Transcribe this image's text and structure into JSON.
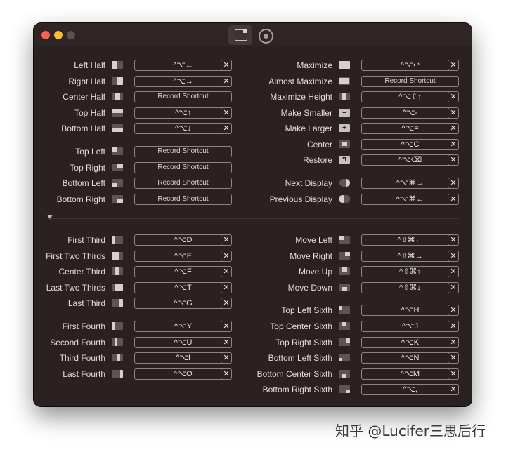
{
  "window": {
    "tabs": [
      {
        "name": "Keyboard Shortcuts",
        "icon": "keyboard-shortcuts-icon",
        "active": true
      },
      {
        "name": "Settings",
        "icon": "gear-icon",
        "active": false
      }
    ]
  },
  "shortcuts": {
    "left": [
      {
        "id": "left-half",
        "label": "Left Half",
        "shortcut": "^⌥←",
        "recorded": true,
        "icon": "left-half-icon"
      },
      {
        "id": "right-half",
        "label": "Right Half",
        "shortcut": "^⌥→",
        "recorded": true,
        "icon": "right-half-icon"
      },
      {
        "id": "center-half",
        "label": "Center Half",
        "shortcut": "Record Shortcut",
        "recorded": false,
        "icon": "center-half-icon"
      },
      {
        "id": "top-half",
        "label": "Top Half",
        "shortcut": "^⌥↑",
        "recorded": true,
        "icon": "top-half-icon"
      },
      {
        "id": "bottom-half",
        "label": "Bottom Half",
        "shortcut": "^⌥↓",
        "recorded": true,
        "icon": "bottom-half-icon"
      },
      {
        "id": "top-left",
        "label": "Top Left",
        "shortcut": "Record Shortcut",
        "recorded": false,
        "icon": "top-left-icon"
      },
      {
        "id": "top-right",
        "label": "Top Right",
        "shortcut": "Record Shortcut",
        "recorded": false,
        "icon": "top-right-icon"
      },
      {
        "id": "bottom-left",
        "label": "Bottom Left",
        "shortcut": "Record Shortcut",
        "recorded": false,
        "icon": "bottom-left-icon"
      },
      {
        "id": "bottom-right",
        "label": "Bottom Right",
        "shortcut": "Record Shortcut",
        "recorded": false,
        "icon": "bottom-right-icon"
      },
      {
        "id": "first-third",
        "label": "First Third",
        "shortcut": "^⌥D",
        "recorded": true,
        "icon": "first-third-icon"
      },
      {
        "id": "first-two-thirds",
        "label": "First Two Thirds",
        "shortcut": "^⌥E",
        "recorded": true,
        "icon": "first-two-thirds-icon"
      },
      {
        "id": "center-third",
        "label": "Center Third",
        "shortcut": "^⌥F",
        "recorded": true,
        "icon": "center-third-icon"
      },
      {
        "id": "last-two-thirds",
        "label": "Last Two Thirds",
        "shortcut": "^⌥T",
        "recorded": true,
        "icon": "last-two-thirds-icon"
      },
      {
        "id": "last-third",
        "label": "Last Third",
        "shortcut": "^⌥G",
        "recorded": true,
        "icon": "last-third-icon"
      },
      {
        "id": "first-fourth",
        "label": "First Fourth",
        "shortcut": "^⌥Y",
        "recorded": true,
        "icon": "first-fourth-icon"
      },
      {
        "id": "second-fourth",
        "label": "Second Fourth",
        "shortcut": "^⌥U",
        "recorded": true,
        "icon": "second-fourth-icon"
      },
      {
        "id": "third-fourth",
        "label": "Third Fourth",
        "shortcut": "^⌥I",
        "recorded": true,
        "icon": "third-fourth-icon"
      },
      {
        "id": "last-fourth",
        "label": "Last Fourth",
        "shortcut": "^⌥O",
        "recorded": true,
        "icon": "last-fourth-icon"
      }
    ],
    "right": [
      {
        "id": "maximize",
        "label": "Maximize",
        "shortcut": "^⌥↩",
        "recorded": true,
        "icon": "maximize-icon"
      },
      {
        "id": "almost-maximize",
        "label": "Almost Maximize",
        "shortcut": "Record Shortcut",
        "recorded": false,
        "icon": "almost-maximize-icon"
      },
      {
        "id": "maximize-height",
        "label": "Maximize Height",
        "shortcut": "^⌥⇧↑",
        "recorded": true,
        "icon": "maximize-height-icon"
      },
      {
        "id": "make-smaller",
        "label": "Make Smaller",
        "shortcut": "^⌥-",
        "recorded": true,
        "icon": "make-smaller-icon"
      },
      {
        "id": "make-larger",
        "label": "Make Larger",
        "shortcut": "^⌥=",
        "recorded": true,
        "icon": "make-larger-icon"
      },
      {
        "id": "center",
        "label": "Center",
        "shortcut": "^⌥C",
        "recorded": true,
        "icon": "center-icon"
      },
      {
        "id": "restore",
        "label": "Restore",
        "shortcut": "^⌥⌫",
        "recorded": true,
        "icon": "restore-icon"
      },
      {
        "id": "next-display",
        "label": "Next Display",
        "shortcut": "^⌥⌘→",
        "recorded": true,
        "icon": "next-display-icon"
      },
      {
        "id": "previous-display",
        "label": "Previous Display",
        "shortcut": "^⌥⌘←",
        "recorded": true,
        "icon": "previous-display-icon"
      },
      {
        "id": "move-left",
        "label": "Move Left",
        "shortcut": "^⇧⌘←",
        "recorded": true,
        "icon": "move-left-icon"
      },
      {
        "id": "move-right",
        "label": "Move Right",
        "shortcut": "^⇧⌘→",
        "recorded": true,
        "icon": "move-right-icon"
      },
      {
        "id": "move-up",
        "label": "Move Up",
        "shortcut": "^⇧⌘↑",
        "recorded": true,
        "icon": "move-up-icon"
      },
      {
        "id": "move-down",
        "label": "Move Down",
        "shortcut": "^⇧⌘↓",
        "recorded": true,
        "icon": "move-down-icon"
      },
      {
        "id": "top-left-sixth",
        "label": "Top Left Sixth",
        "shortcut": "^⌥H",
        "recorded": true,
        "icon": "top-left-sixth-icon"
      },
      {
        "id": "top-center-sixth",
        "label": "Top Center Sixth",
        "shortcut": "^⌥J",
        "recorded": true,
        "icon": "top-center-sixth-icon"
      },
      {
        "id": "top-right-sixth",
        "label": "Top Right Sixth",
        "shortcut": "^⌥K",
        "recorded": true,
        "icon": "top-right-sixth-icon"
      },
      {
        "id": "bottom-left-sixth",
        "label": "Bottom Left Sixth",
        "shortcut": "^⌥N",
        "recorded": true,
        "icon": "bottom-left-sixth-icon"
      },
      {
        "id": "bottom-center-sixth",
        "label": "Bottom Center Sixth",
        "shortcut": "^⌥M",
        "recorded": true,
        "icon": "bottom-center-sixth-icon"
      },
      {
        "id": "bottom-right-sixth",
        "label": "Bottom Right Sixth",
        "shortcut": "^⌥,",
        "recorded": true,
        "icon": "bottom-right-sixth-icon"
      }
    ]
  },
  "clear_symbol": "✕",
  "disclosure_icon": "disclosure-triangle-icon",
  "watermark": "知乎 @Lucifer三思后行",
  "colors": {
    "window_bg": "#2b2121",
    "text": "#e4dcdc",
    "field_border": "#8d8484",
    "close": "#ff5f57",
    "minimize": "#febc2e"
  }
}
